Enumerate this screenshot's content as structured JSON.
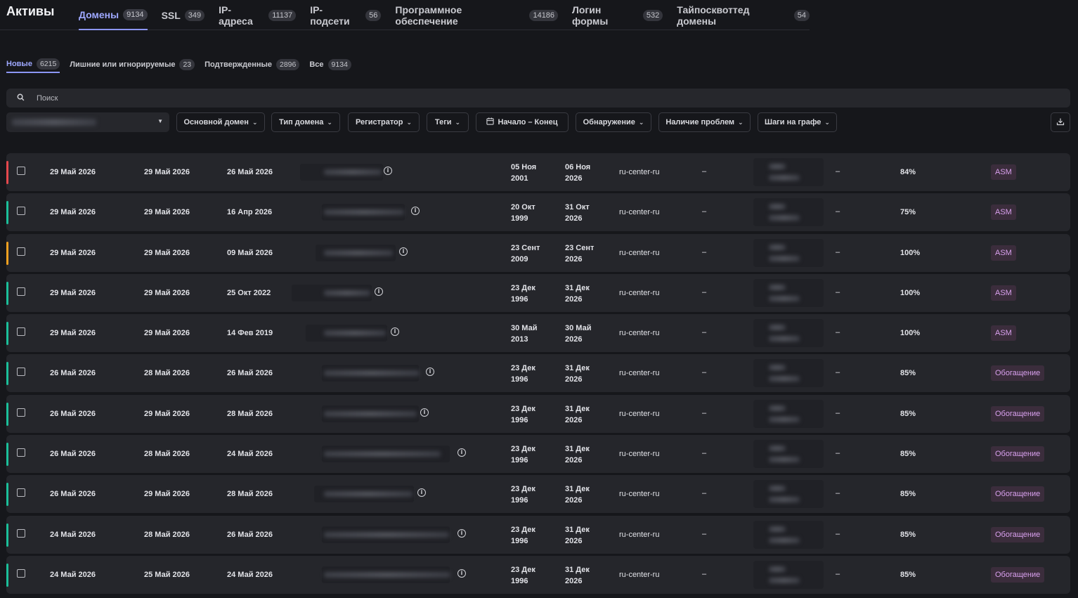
{
  "app": {
    "title": "Активы"
  },
  "tabs": [
    {
      "label": "Домены",
      "count": "9134",
      "active": true
    },
    {
      "label": "SSL",
      "count": "349"
    },
    {
      "label": "IP-адреса",
      "count": "11137"
    },
    {
      "label": "IP-подсети",
      "count": "56"
    },
    {
      "label": "Программное обеспечение",
      "count": "14186"
    },
    {
      "label": "Логин формы",
      "count": "532"
    },
    {
      "label": "Тайпосквоттед домены",
      "count": "54"
    }
  ],
  "subtabs": [
    {
      "label": "Новые",
      "count": "6215",
      "active": true
    },
    {
      "label": "Лишние или игнорируемые",
      "count": "23"
    },
    {
      "label": "Подтвержденные",
      "count": "2896"
    },
    {
      "label": "Все",
      "count": "9134"
    }
  ],
  "search": {
    "placeholder": "Поиск"
  },
  "filters": {
    "main_domain": "Основной домен",
    "domain_type": "Тип домена",
    "registrar": "Регистратор",
    "tags": "Теги",
    "date_range": "Начало – Конец",
    "detection": "Обнаружение",
    "issues": "Наличие проблем",
    "graph_steps": "Шаги на графе"
  },
  "colors": {
    "red": "#e5484d",
    "green": "#1bbf9a",
    "orange": "#f0a020",
    "accent": "#8c96f5"
  },
  "rows": [
    {
      "stripe": "red",
      "d1": "29 Май 2026",
      "d2": "29 Май 2026",
      "d3": "26 Май 2026",
      "created_day": "05 Ноя",
      "created_year": "2001",
      "expires_day": "06 Ноя",
      "expires_year": "2026",
      "registrar": "ru-center-ru",
      "dash1": "–",
      "dash2": "–",
      "score": "84%",
      "source": "ASM"
    },
    {
      "stripe": "green",
      "d1": "29 Май 2026",
      "d2": "29 Май 2026",
      "d3": "16 Апр 2026",
      "created_day": "20 Окт",
      "created_year": "1999",
      "expires_day": "31 Окт",
      "expires_year": "2026",
      "registrar": "ru-center-ru",
      "dash1": "–",
      "dash2": "–",
      "score": "75%",
      "source": "ASM"
    },
    {
      "stripe": "orange",
      "d1": "29 Май 2026",
      "d2": "29 Май 2026",
      "d3": "09 Май 2026",
      "created_day": "23 Сент",
      "created_year": "2009",
      "expires_day": "23 Сент",
      "expires_year": "2026",
      "registrar": "ru-center-ru",
      "dash1": "–",
      "dash2": "–",
      "score": "100%",
      "source": "ASM"
    },
    {
      "stripe": "green",
      "d1": "29 Май 2026",
      "d2": "29 Май 2026",
      "d3": "25 Окт 2022",
      "created_day": "23 Дек",
      "created_year": "1996",
      "expires_day": "31 Дек",
      "expires_year": "2026",
      "registrar": "ru-center-ru",
      "dash1": "–",
      "dash2": "–",
      "score": "100%",
      "source": "ASM"
    },
    {
      "stripe": "green",
      "d1": "29 Май 2026",
      "d2": "29 Май 2026",
      "d3": "14 Фев 2019",
      "created_day": "30 Май",
      "created_year": "2013",
      "expires_day": "30 Май",
      "expires_year": "2026",
      "registrar": "ru-center-ru",
      "dash1": "–",
      "dash2": "–",
      "score": "100%",
      "source": "ASM"
    },
    {
      "stripe": "green",
      "d1": "26 Май 2026",
      "d2": "28 Май 2026",
      "d3": "26 Май 2026",
      "created_day": "23 Дек",
      "created_year": "1996",
      "expires_day": "31 Дек",
      "expires_year": "2026",
      "registrar": "ru-center-ru",
      "dash1": "–",
      "dash2": "–",
      "score": "85%",
      "source": "Обогащение"
    },
    {
      "stripe": "green",
      "d1": "26 Май 2026",
      "d2": "29 Май 2026",
      "d3": "28 Май 2026",
      "created_day": "23 Дек",
      "created_year": "1996",
      "expires_day": "31 Дек",
      "expires_year": "2026",
      "registrar": "ru-center-ru",
      "dash1": "–",
      "dash2": "–",
      "score": "85%",
      "source": "Обогащение"
    },
    {
      "stripe": "green",
      "d1": "26 Май 2026",
      "d2": "28 Май 2026",
      "d3": "24 Май 2026",
      "created_day": "23 Дек",
      "created_year": "1996",
      "expires_day": "31 Дек",
      "expires_year": "2026",
      "registrar": "ru-center-ru",
      "dash1": "–",
      "dash2": "–",
      "score": "85%",
      "source": "Обогащение"
    },
    {
      "stripe": "green",
      "d1": "26 Май 2026",
      "d2": "29 Май 2026",
      "d3": "28 Май 2026",
      "created_day": "23 Дек",
      "created_year": "1996",
      "expires_day": "31 Дек",
      "expires_year": "2026",
      "registrar": "ru-center-ru",
      "dash1": "–",
      "dash2": "–",
      "score": "85%",
      "source": "Обогащение"
    },
    {
      "stripe": "green",
      "d1": "24 Май 2026",
      "d2": "28 Май 2026",
      "d3": "26 Май 2026",
      "created_day": "23 Дек",
      "created_year": "1996",
      "expires_day": "31 Дек",
      "expires_year": "2026",
      "registrar": "ru-center-ru",
      "dash1": "–",
      "dash2": "–",
      "score": "85%",
      "source": "Обогащение"
    },
    {
      "stripe": "green",
      "d1": "24 Май 2026",
      "d2": "25 Май 2026",
      "d3": "24 Май 2026",
      "created_day": "23 Дек",
      "created_year": "1996",
      "expires_day": "31 Дек",
      "expires_year": "2026",
      "registrar": "ru-center-ru",
      "dash1": "–",
      "dash2": "–",
      "score": "85%",
      "source": "Обогащение"
    }
  ]
}
